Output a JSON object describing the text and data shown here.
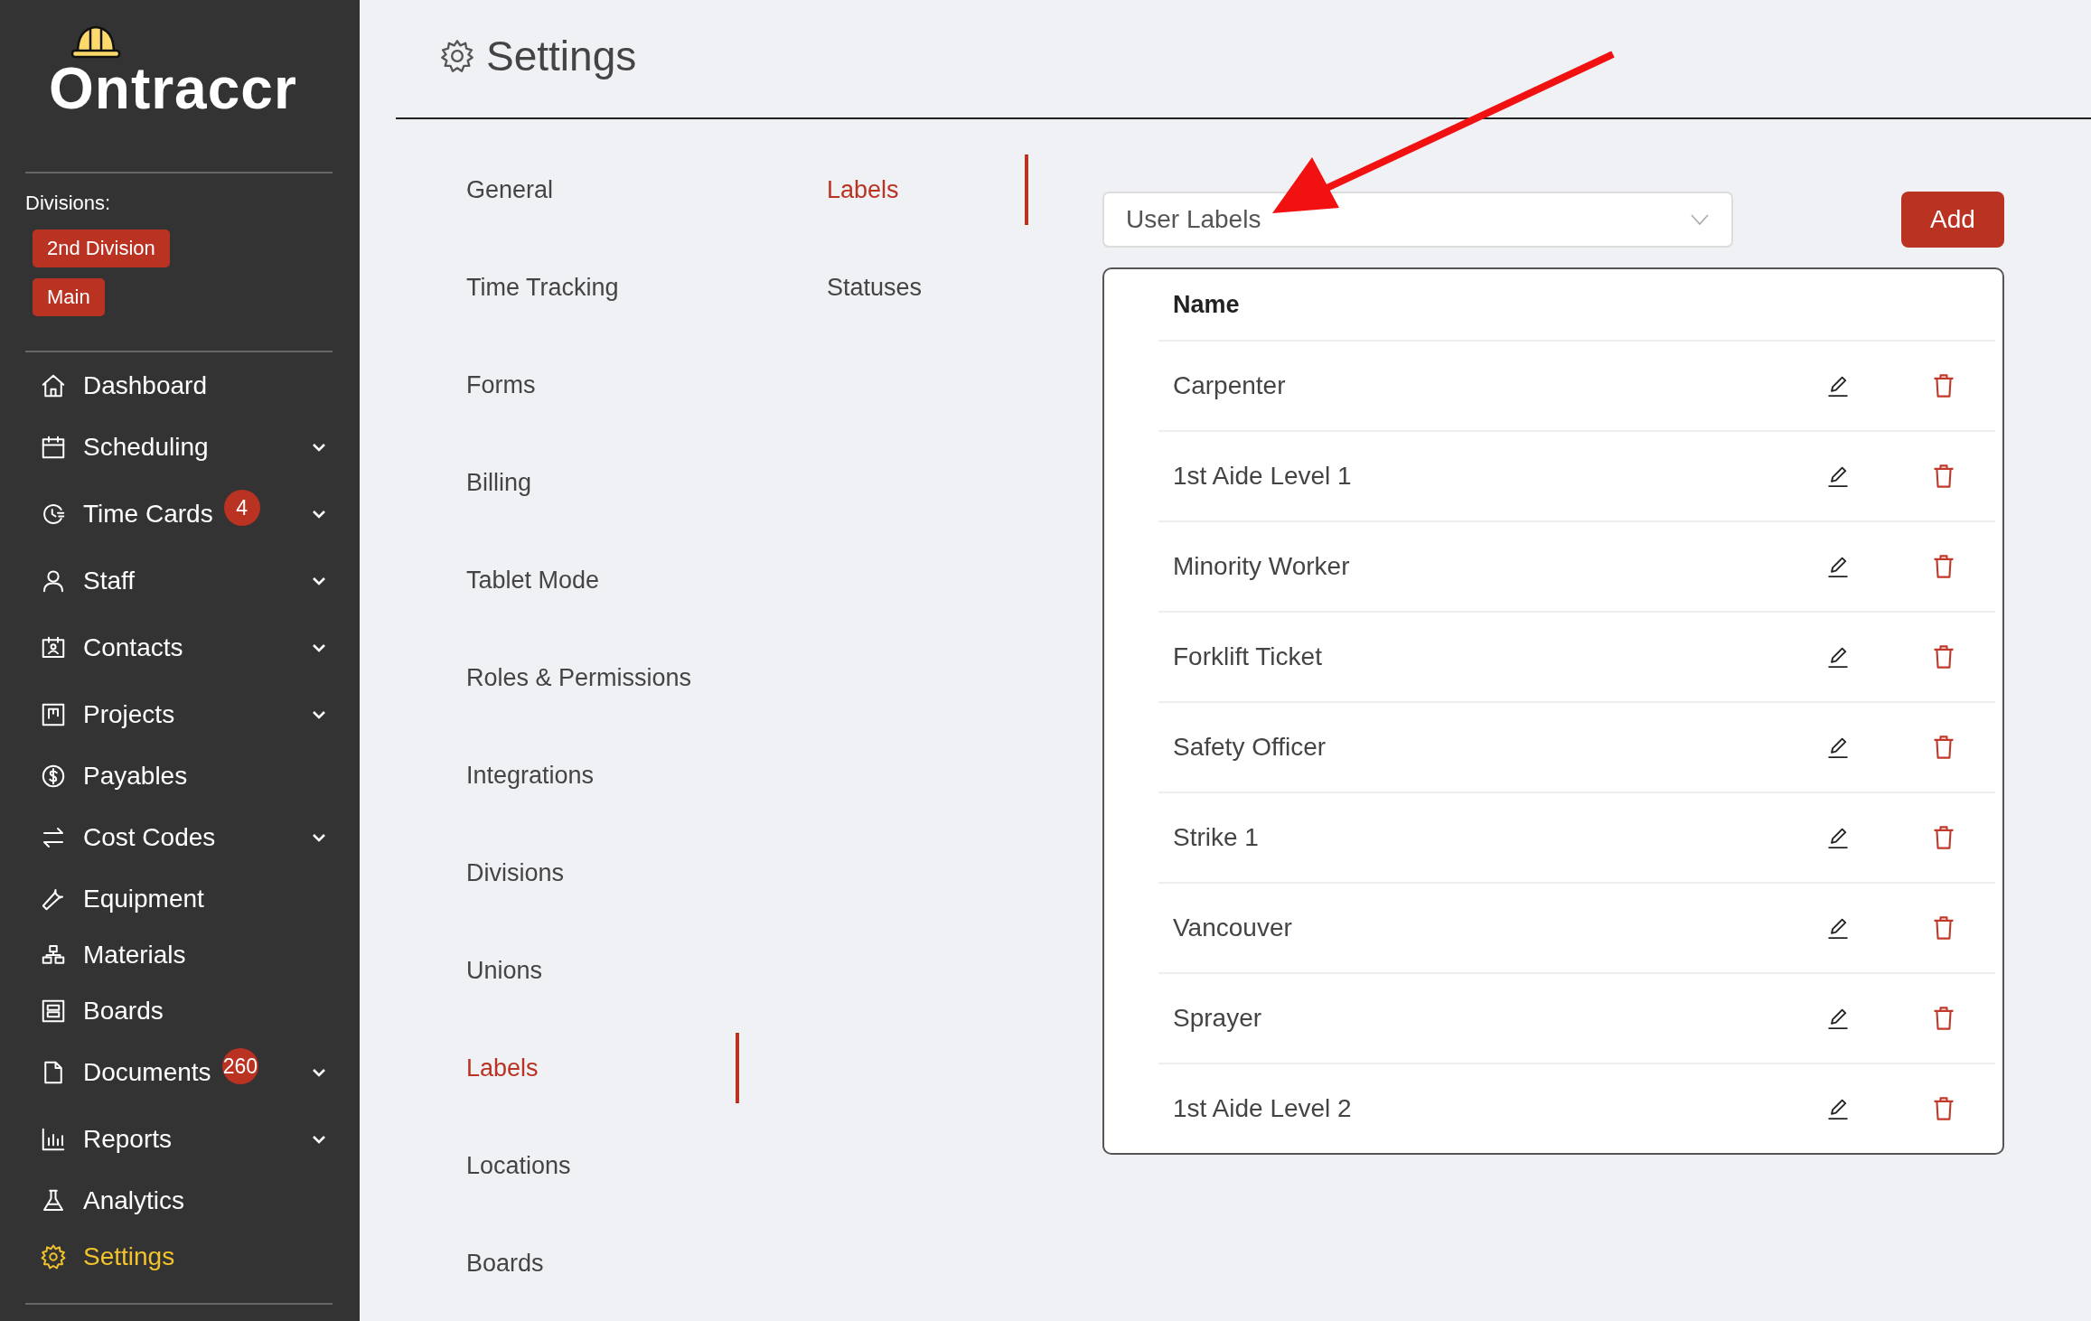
{
  "sidebar": {
    "logo": "Ontraccr",
    "divisions_label": "Divisions:",
    "divisions": [
      "2nd Division",
      "Main"
    ],
    "items": [
      {
        "label": "Dashboard",
        "expandable": false,
        "selected": false
      },
      {
        "label": "Scheduling",
        "expandable": true,
        "selected": false
      },
      {
        "label": "Time Cards",
        "badge": "4",
        "expandable": true,
        "selected": false
      },
      {
        "label": "Staff",
        "expandable": true,
        "selected": false
      },
      {
        "label": "Contacts",
        "expandable": true,
        "selected": false
      },
      {
        "label": "Projects",
        "expandable": true,
        "selected": false
      },
      {
        "label": "Payables",
        "expandable": false,
        "selected": false
      },
      {
        "label": "Cost Codes",
        "expandable": true,
        "selected": false
      },
      {
        "label": "Equipment",
        "expandable": false,
        "selected": false
      },
      {
        "label": "Materials",
        "expandable": false,
        "selected": false
      },
      {
        "label": "Boards",
        "expandable": false,
        "selected": false
      },
      {
        "label": "Documents",
        "badge": "260",
        "expandable": true,
        "selected": false
      },
      {
        "label": "Reports",
        "expandable": true,
        "selected": false
      },
      {
        "label": "Analytics",
        "expandable": false,
        "selected": false
      },
      {
        "label": "Settings",
        "expandable": false,
        "selected": true
      }
    ]
  },
  "page": {
    "title": "Settings"
  },
  "settings_menu": [
    {
      "label": "General",
      "selected": false
    },
    {
      "label": "Time Tracking",
      "selected": false
    },
    {
      "label": "Forms",
      "selected": false
    },
    {
      "label": "Billing",
      "selected": false
    },
    {
      "label": "Tablet Mode",
      "selected": false
    },
    {
      "label": "Roles & Permissions",
      "selected": false
    },
    {
      "label": "Integrations",
      "selected": false
    },
    {
      "label": "Divisions",
      "selected": false
    },
    {
      "label": "Unions",
      "selected": false
    },
    {
      "label": "Labels",
      "selected": true
    },
    {
      "label": "Locations",
      "selected": false
    },
    {
      "label": "Boards",
      "selected": false
    }
  ],
  "labels_menu": [
    {
      "label": "Labels",
      "selected": true
    },
    {
      "label": "Statuses",
      "selected": false
    }
  ],
  "label_type_select": {
    "value": "User Labels"
  },
  "add_button": "Add",
  "table": {
    "columns": [
      "Name"
    ],
    "rows": [
      "Carpenter",
      "1st Aide Level 1",
      "Minority Worker",
      "Forklift Ticket",
      "Safety Officer",
      "Strike 1",
      "Vancouver",
      "Sprayer",
      "1st Aide Level 2"
    ]
  }
}
